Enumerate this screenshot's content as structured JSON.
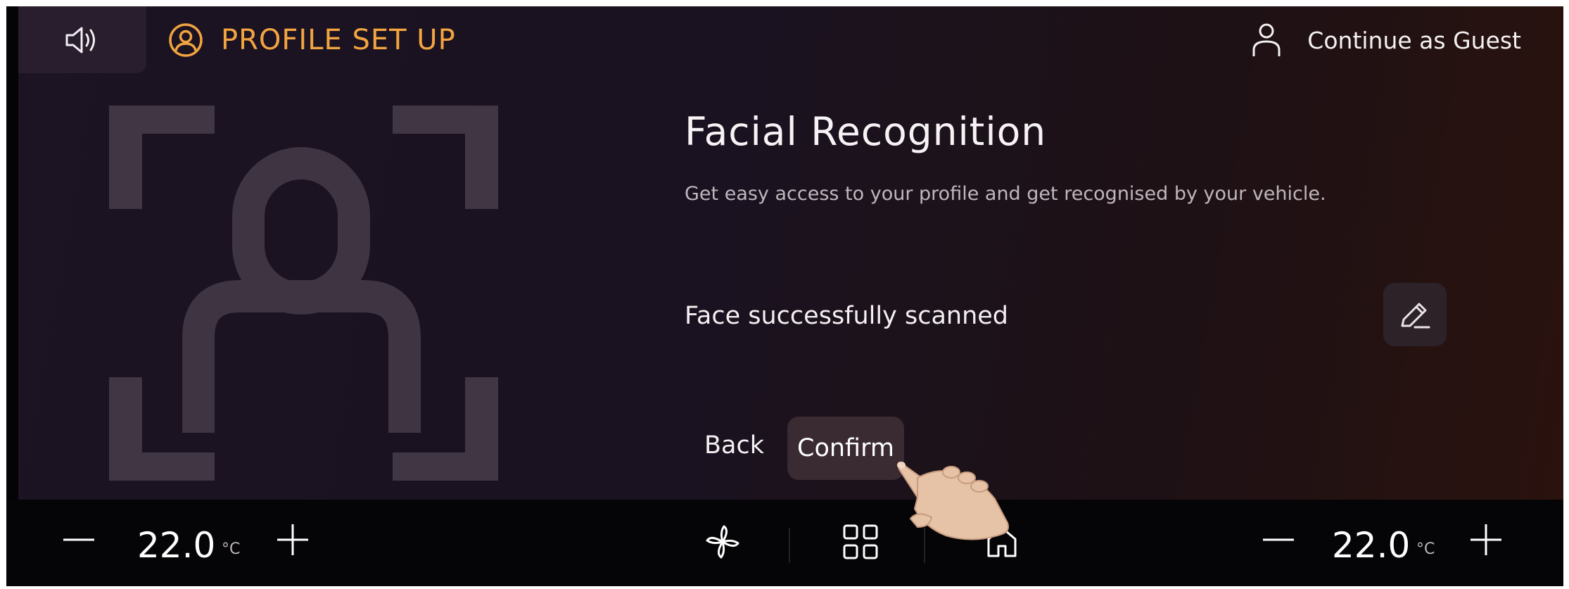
{
  "header": {
    "profile_title": "PROFILE SET UP",
    "guest_label": "Continue as Guest",
    "speaker_icon": "speaker-icon",
    "profile_icon": "user-circle-icon",
    "guest_icon": "user-outline-icon"
  },
  "main": {
    "title": "Facial Recognition",
    "subtitle": "Get easy access to your profile and get recognised by your vehicle.",
    "status": "Face successfully scanned",
    "edit_icon": "pencil-icon",
    "back_label": "Back",
    "confirm_label": "Confirm"
  },
  "climate": {
    "left": {
      "minus": "—",
      "temp": "22.0",
      "unit": "°C",
      "plus": "+"
    },
    "right": {
      "minus": "—",
      "temp": "22.0",
      "unit": "°C",
      "plus": "+"
    },
    "icons": [
      "fan-icon",
      "apps-grid-icon",
      "home-icon"
    ]
  },
  "colors": {
    "accent": "#f2a440",
    "background": "#1c1323",
    "button": "#3a2a32"
  }
}
